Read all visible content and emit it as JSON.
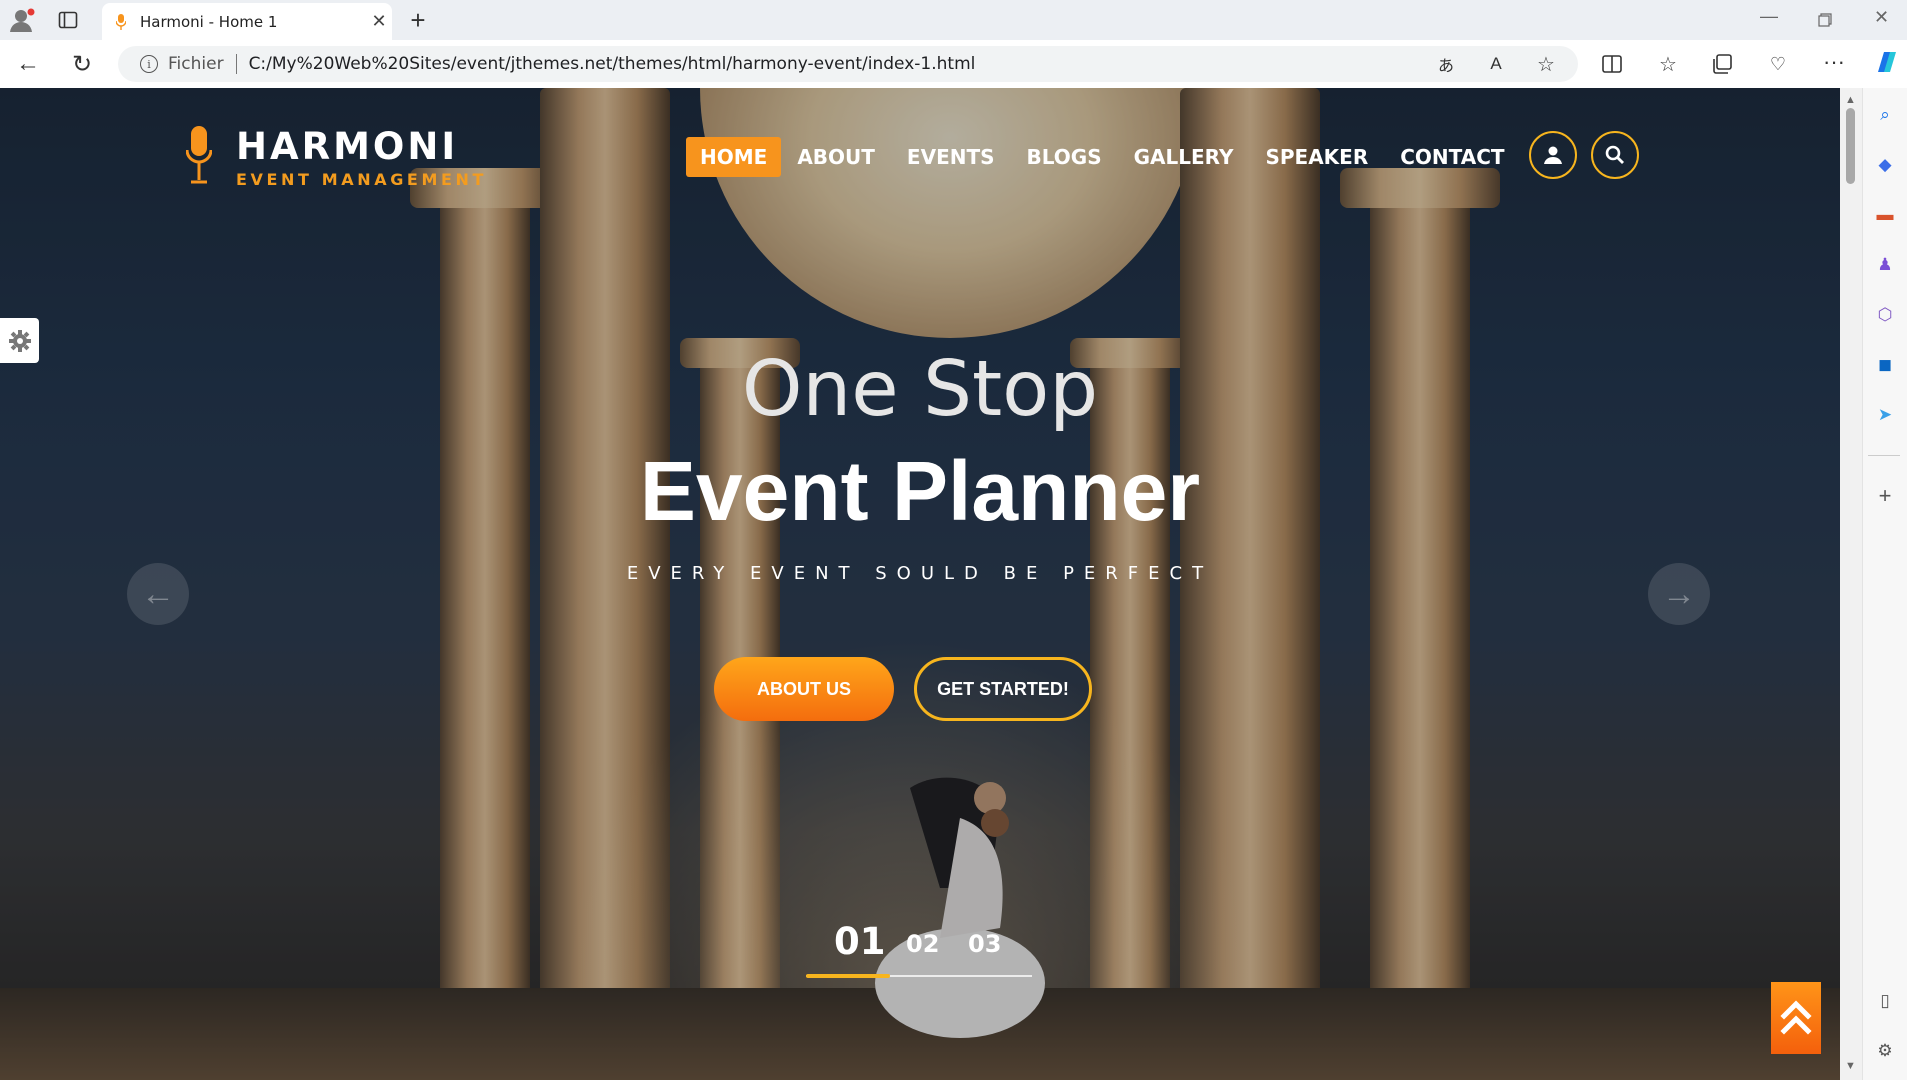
{
  "browser": {
    "tab_title": "Harmoni - Home 1",
    "address_scheme": "Fichier",
    "address_url": "C:/My%20Web%20Sites/event/jthemes.net/themes/html/harmony-event/index-1.html"
  },
  "site": {
    "logo_name": "HARMONI",
    "logo_sub": "EVENT MANAGEMENT",
    "nav": [
      "HOME",
      "ABOUT",
      "EVENTS",
      "BLOGS",
      "GALLERY",
      "SPEAKER",
      "CONTACT"
    ],
    "active_nav": "HOME",
    "accent_color": "#f7941d",
    "accent_outline": "#f7b51e"
  },
  "hero": {
    "line1": "One Stop",
    "line2": "Event Planner",
    "tagline": "EVERY EVENT SOULD BE PERFECT",
    "btn_primary": "ABOUT US",
    "btn_secondary": "GET STARTED!",
    "slides": [
      "01",
      "02",
      "03"
    ],
    "current_slide": "01"
  }
}
